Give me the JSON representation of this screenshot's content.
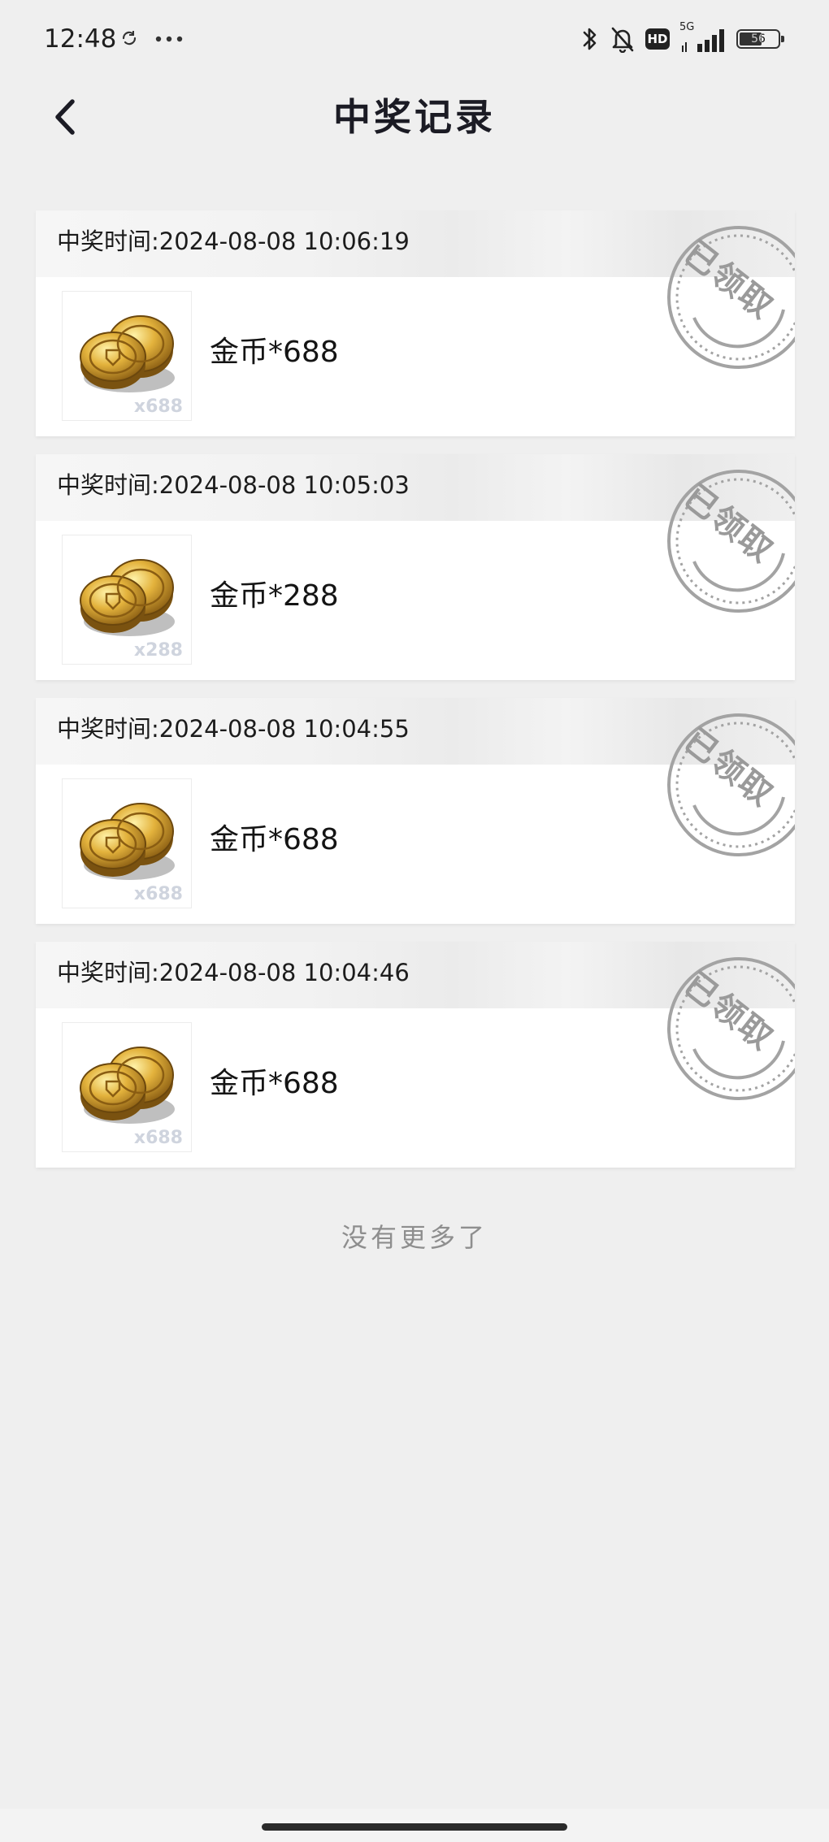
{
  "status_bar": {
    "time": "12:48",
    "network": "5G",
    "battery": "56",
    "hd": "HD"
  },
  "header": {
    "title": "中奖记录"
  },
  "records": [
    {
      "time_label": "中奖时间:2024-08-08 10:06:19",
      "prize_name": "金币*688",
      "thumb_qty": "x688",
      "status": "已领取"
    },
    {
      "time_label": "中奖时间:2024-08-08 10:05:03",
      "prize_name": "金币*288",
      "thumb_qty": "x288",
      "status": "已领取"
    },
    {
      "time_label": "中奖时间:2024-08-08 10:04:55",
      "prize_name": "金币*688",
      "thumb_qty": "x688",
      "status": "已领取"
    },
    {
      "time_label": "中奖时间:2024-08-08 10:04:46",
      "prize_name": "金币*688",
      "thumb_qty": "x688",
      "status": "已领取"
    }
  ],
  "footer": {
    "no_more": "没有更多了"
  },
  "icons": {
    "back": "chevron-left-icon",
    "bluetooth": "bluetooth-icon",
    "mute": "bell-off-icon",
    "coin": "gold-coins-icon"
  },
  "colors": {
    "background": "#efefef",
    "card": "#ffffff",
    "stamp": "#9a9a9a",
    "muted_text": "#8e8e8e"
  }
}
